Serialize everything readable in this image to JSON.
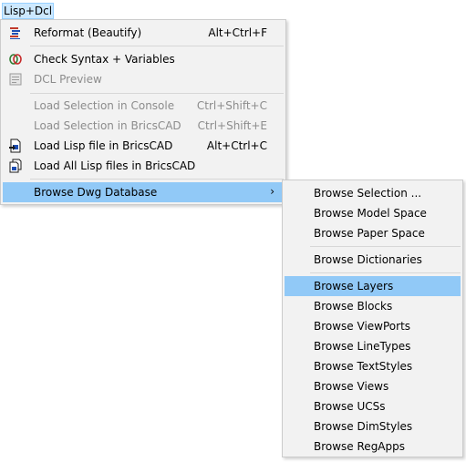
{
  "menubar": {
    "title": "Lisp+Dcl"
  },
  "main_menu": {
    "items": [
      {
        "label": "Reformat (Beautify)",
        "shortcut": "Alt+Ctrl+F",
        "icon": "reformat-icon"
      },
      {
        "label": "Check Syntax + Variables",
        "shortcut": "",
        "icon": "check-syntax-icon"
      },
      {
        "label": "DCL Preview",
        "shortcut": "",
        "icon": "dcl-preview-icon"
      },
      {
        "label": "Load Selection in Console",
        "shortcut": "Ctrl+Shift+C"
      },
      {
        "label": "Load Selection in BricsCAD",
        "shortcut": "Ctrl+Shift+E"
      },
      {
        "label": "Load Lisp file in BricsCAD",
        "shortcut": "Alt+Ctrl+C",
        "icon": "load-lisp-icon"
      },
      {
        "label": "Load All Lisp files in BricsCAD",
        "shortcut": "",
        "icon": "load-all-lisp-icon"
      },
      {
        "label": "Browse Dwg Database",
        "submenu_arrow": "›"
      }
    ]
  },
  "sub_menu": {
    "items": [
      {
        "label": "Browse Selection ..."
      },
      {
        "label": "Browse Model Space"
      },
      {
        "label": "Browse Paper Space"
      },
      {
        "label": "Browse Dictionaries"
      },
      {
        "label": "Browse Layers"
      },
      {
        "label": "Browse Blocks"
      },
      {
        "label": "Browse ViewPorts"
      },
      {
        "label": "Browse LineTypes"
      },
      {
        "label": "Browse TextStyles"
      },
      {
        "label": "Browse Views"
      },
      {
        "label": "Browse UCSs"
      },
      {
        "label": "Browse DimStyles"
      },
      {
        "label": "Browse RegApps"
      }
    ]
  },
  "colors": {
    "highlight": "#91c9f7",
    "menubar_active": "#cce8ff",
    "menu_background": "#f2f2f2",
    "disabled_text": "#8c8c8c"
  }
}
